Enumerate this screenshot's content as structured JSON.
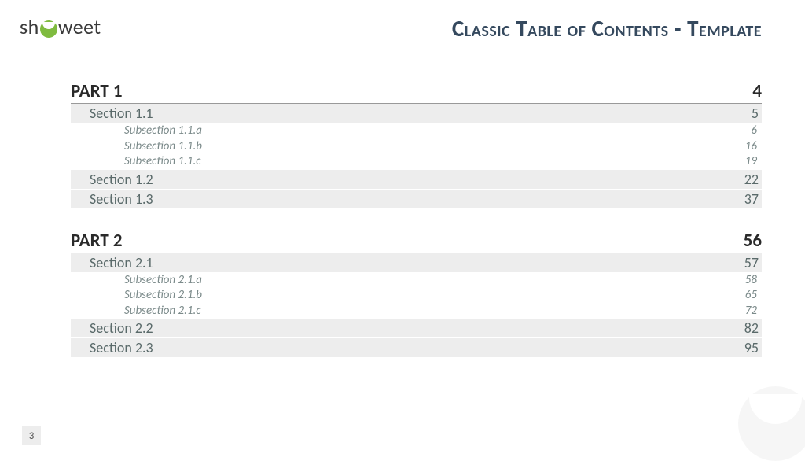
{
  "brand": {
    "sh": "sh",
    "weet": "weet"
  },
  "title": "Classic Table of Contents - Template",
  "page_number": "3",
  "toc": [
    {
      "label": "PART 1",
      "page": "4",
      "sections": [
        {
          "label": "Section 1.1",
          "page": "5",
          "subs": [
            {
              "label": "Subsection 1.1.a",
              "page": "6"
            },
            {
              "label": "Subsection 1.1.b",
              "page": "16"
            },
            {
              "label": "Subsection 1.1.c",
              "page": "19"
            }
          ]
        },
        {
          "label": "Section 1.2",
          "page": "22",
          "subs": []
        },
        {
          "label": "Section 1.3",
          "page": "37",
          "subs": []
        }
      ]
    },
    {
      "label": "PART 2",
      "page": "56",
      "sections": [
        {
          "label": "Section 2.1",
          "page": "57",
          "subs": [
            {
              "label": "Subsection 2.1.a",
              "page": "58"
            },
            {
              "label": "Subsection 2.1.b",
              "page": "65"
            },
            {
              "label": "Subsection 2.1.c",
              "page": "72"
            }
          ]
        },
        {
          "label": "Section 2.2",
          "page": "82",
          "subs": []
        },
        {
          "label": "Section 2.3",
          "page": "95",
          "subs": []
        }
      ]
    }
  ]
}
